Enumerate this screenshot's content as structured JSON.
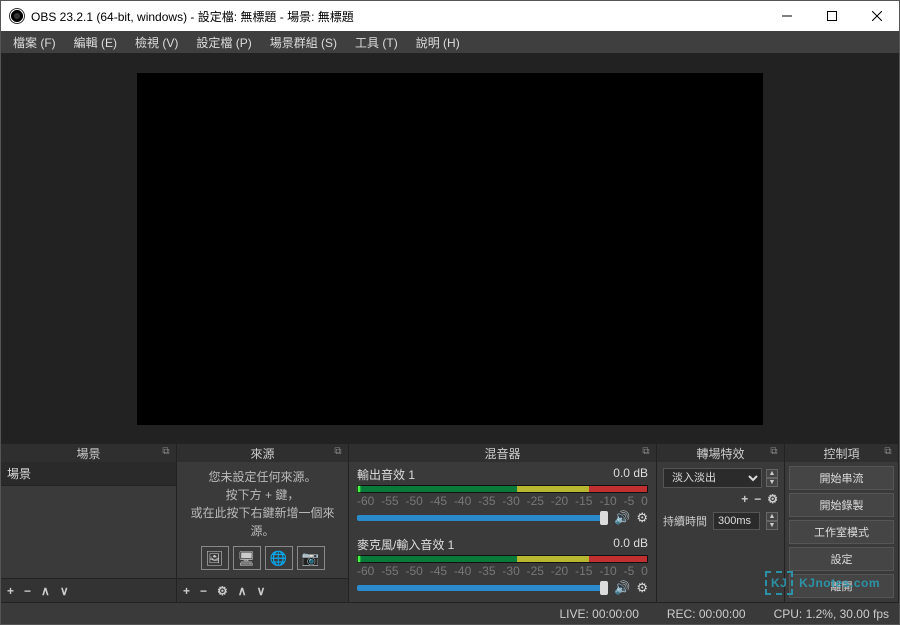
{
  "title": "OBS 23.2.1 (64-bit, windows) - 設定檔: 無標題 - 場景: 無標題",
  "menu": {
    "file": "檔案 (F)",
    "edit": "編輯 (E)",
    "view": "檢視 (V)",
    "profile": "設定檔 (P)",
    "scenecol": "場景群組 (S)",
    "tools": "工具 (T)",
    "help": "說明 (H)"
  },
  "panels": {
    "scenes": "場景",
    "sources": "來源",
    "mixer": "混音器",
    "transitions": "轉場特效",
    "controls": "控制項"
  },
  "scenes": {
    "item1": "場景"
  },
  "sources": {
    "hint1": "您未設定任何來源。",
    "hint2": "按下方 + 鍵，",
    "hint3": "或在此按下右鍵新增一個來源。"
  },
  "mixer": {
    "ch1_name": "輸出音效 1",
    "ch1_db": "0.0 dB",
    "ch2_name": "麥克風/輸入音效 1",
    "ch2_db": "0.0 dB",
    "ticks": [
      "-60",
      "-55",
      "-50",
      "-45",
      "-40",
      "-35",
      "-30",
      "-25",
      "-20",
      "-15",
      "-10",
      "-5",
      "0"
    ]
  },
  "trans": {
    "selected": "淡入淡出",
    "dur_label": "持續時間",
    "dur_value": "300ms"
  },
  "ctrls": {
    "stream": "開始串流",
    "record": "開始錄製",
    "studio": "工作室模式",
    "settings": "設定",
    "exit": "離開"
  },
  "status": {
    "live": "LIVE: 00:00:00",
    "rec": "REC: 00:00:00",
    "cpu": "CPU: 1.2%, 30.00 fps"
  },
  "watermark": {
    "logo": "KJ",
    "text": "KJnotes.com"
  }
}
